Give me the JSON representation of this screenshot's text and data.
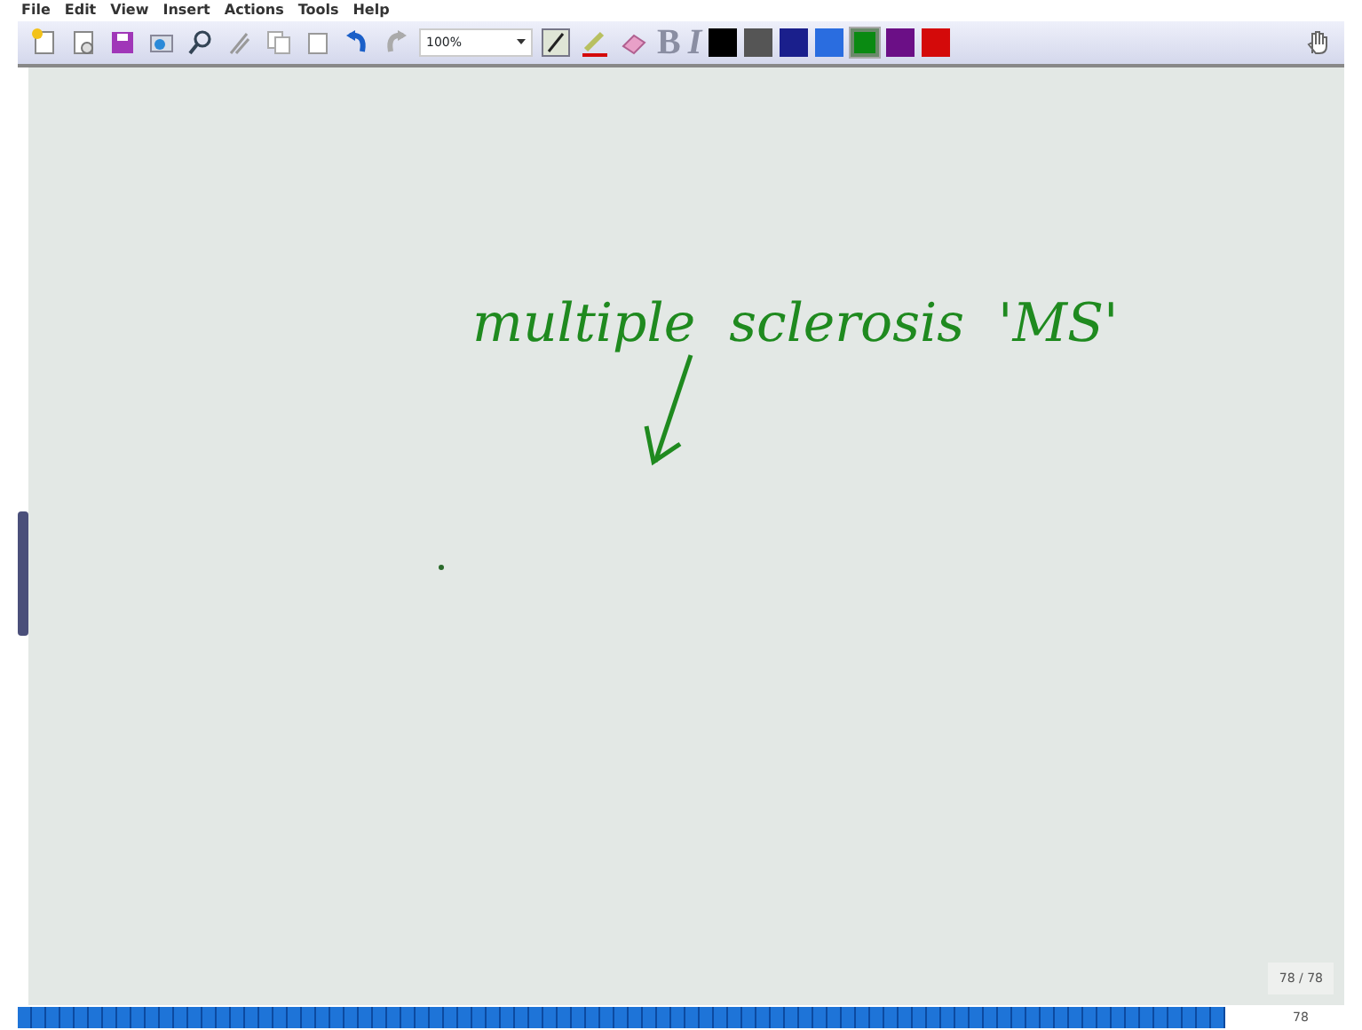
{
  "menu": [
    "File",
    "Edit",
    "View",
    "Insert",
    "Actions",
    "Tools",
    "Help"
  ],
  "toolbar": {
    "zoom": "100%",
    "bold": {
      "label": "B",
      "disabled": true
    },
    "italic": {
      "label": "I",
      "disabled": true
    }
  },
  "colors": [
    {
      "color": "#000000",
      "selected": false
    },
    {
      "color": "#555555",
      "selected": false
    },
    {
      "color": "#1a1f8c",
      "selected": false
    },
    {
      "color": "#2a6de0",
      "selected": false
    },
    {
      "color": "#0a8a12",
      "selected": true
    },
    {
      "color": "#6b0f86",
      "selected": false
    },
    {
      "color": "#d40a0a",
      "selected": false
    }
  ],
  "ink": {
    "text": "multiple  sclerosis  'MS'"
  },
  "page_counter": "78 / 78",
  "page_number": "78"
}
